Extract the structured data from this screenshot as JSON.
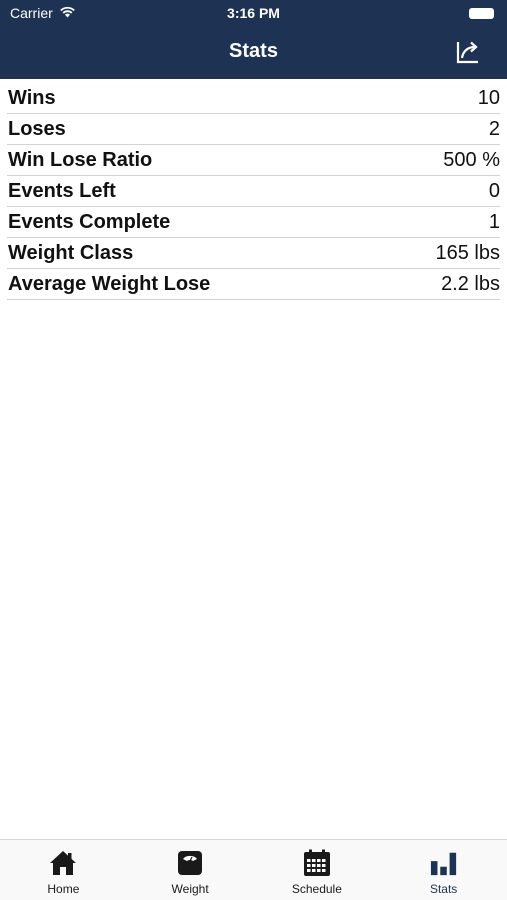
{
  "status_bar": {
    "carrier": "Carrier",
    "time": "3:16 PM"
  },
  "nav": {
    "title": "Stats",
    "share_icon": "share-icon"
  },
  "stats": [
    {
      "label": "Wins",
      "value": "10"
    },
    {
      "label": "Loses",
      "value": "2"
    },
    {
      "label": "Win Lose Ratio",
      "value": "500 %"
    },
    {
      "label": "Events Left",
      "value": "0"
    },
    {
      "label": "Events Complete",
      "value": "1"
    },
    {
      "label": "Weight Class",
      "value": "165 lbs"
    },
    {
      "label": "Average Weight Lose",
      "value": "2.2 lbs"
    }
  ],
  "tabs": [
    {
      "label": "Home",
      "icon": "house-icon"
    },
    {
      "label": "Weight",
      "icon": "scale-icon"
    },
    {
      "label": "Schedule",
      "icon": "calendar-icon"
    },
    {
      "label": "Stats",
      "icon": "bar-chart-icon",
      "selected": true
    }
  ],
  "colors": {
    "header": "#1e3354",
    "accent": "#1e3354",
    "separator": "#d3d3d7"
  }
}
